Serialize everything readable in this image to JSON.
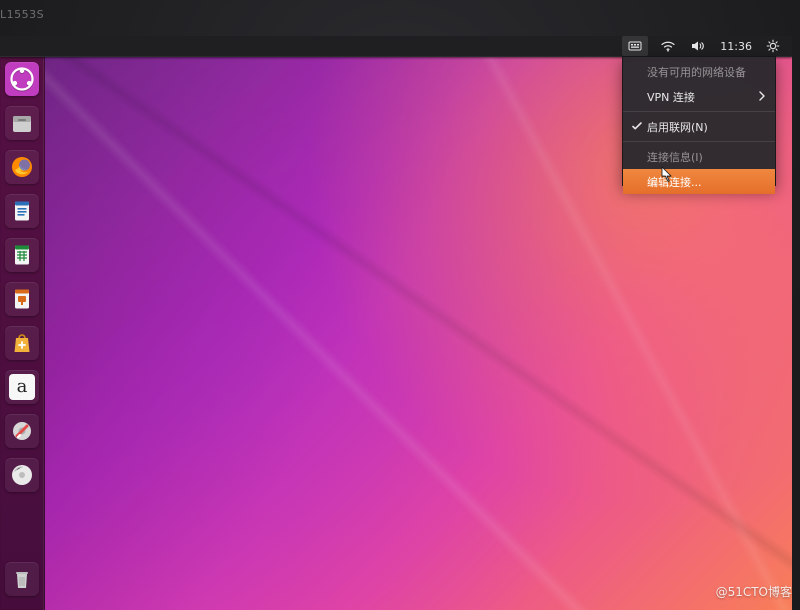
{
  "bezel": {
    "label": "L1553S"
  },
  "top_panel": {
    "time": "11:36",
    "icons": {
      "keyboard": "keyboard-icon",
      "wifi": "wifi-icon",
      "sound": "speaker-icon",
      "settings": "gear-icon"
    }
  },
  "network_menu": {
    "no_devices": "没有可用的网络设备",
    "vpn_label": "VPN 连接",
    "enable_networking": "启用联网(N)",
    "connection_info": "连接信息(I)",
    "edit_connections": "编辑连接..."
  },
  "launcher": {
    "items": [
      {
        "name": "ubuntu-home",
        "icon": "ubuntu-logo-icon"
      },
      {
        "name": "files",
        "icon": "files-icon"
      },
      {
        "name": "firefox",
        "icon": "firefox-icon"
      },
      {
        "name": "writer",
        "icon": "document-icon"
      },
      {
        "name": "calc",
        "icon": "spreadsheet-icon"
      },
      {
        "name": "impress",
        "icon": "presentation-icon"
      },
      {
        "name": "software",
        "icon": "software-bag-icon"
      },
      {
        "name": "amazon",
        "icon": "amazon-icon"
      },
      {
        "name": "settings",
        "icon": "settings-icon"
      },
      {
        "name": "disc",
        "icon": "disc-icon"
      },
      {
        "name": "trash",
        "icon": "trash-icon"
      }
    ],
    "amazon_letter": "a"
  },
  "watermark": {
    "text": "@51CTO博客"
  },
  "colors": {
    "menu_bg": "#2a2a2e",
    "highlight": "#e46f2b",
    "ubuntu_accent": "#c03dbf"
  }
}
